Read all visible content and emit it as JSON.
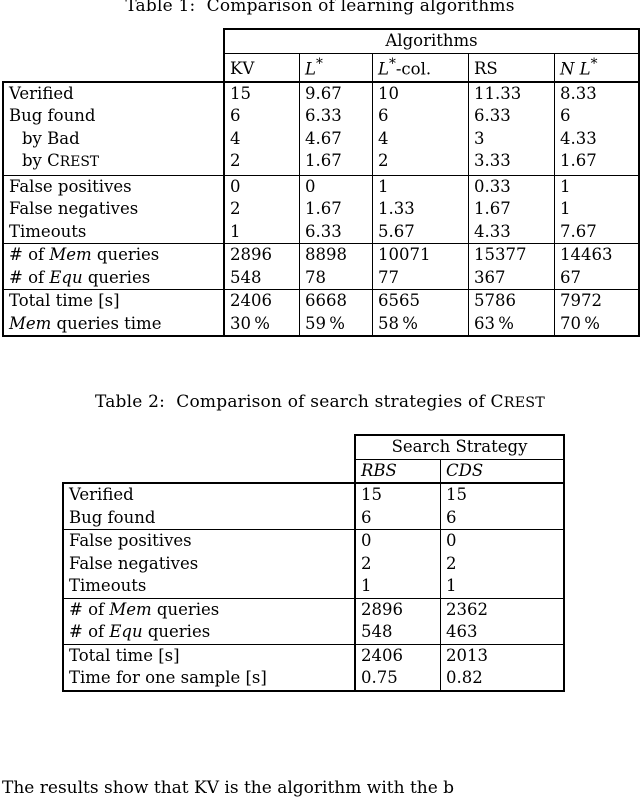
{
  "document": {
    "table1": {
      "caption": "Table 1:  Comparison of learning algorithms",
      "group_header": "Algorithms",
      "columns": [
        "KV",
        "L*",
        "L*-col.",
        "RS",
        "NL*"
      ],
      "column_styles": [
        "upright",
        "italic-math",
        "italic-math",
        "upright",
        "italic-math"
      ],
      "rows": [
        {
          "label": "Verified",
          "indent": false,
          "italic_word": "",
          "values": [
            "15",
            "9.67",
            "10",
            "11.33",
            "8.33"
          ]
        },
        {
          "label": "Bug found",
          "indent": false,
          "italic_word": "",
          "values": [
            "6",
            "6.33",
            "6",
            "6.33",
            "6"
          ]
        },
        {
          "label": "by Bad",
          "indent": true,
          "italic_word": "",
          "values": [
            "4",
            "4.67",
            "4",
            "3",
            "4.33"
          ]
        },
        {
          "label": "by CREST",
          "indent": true,
          "italic_word": "",
          "values": [
            "2",
            "1.67",
            "2",
            "3.33",
            "1.67"
          ]
        },
        {
          "label": "False positives",
          "indent": false,
          "italic_word": "",
          "values": [
            "0",
            "0",
            "1",
            "0.33",
            "1"
          ]
        },
        {
          "label": "False negatives",
          "indent": false,
          "italic_word": "",
          "values": [
            "2",
            "1.67",
            "1.33",
            "1.67",
            "1"
          ]
        },
        {
          "label": "Timeouts",
          "indent": false,
          "italic_word": "",
          "values": [
            "1",
            "6.33",
            "5.67",
            "4.33",
            "7.67"
          ]
        },
        {
          "label": "# of Mem queries",
          "indent": false,
          "italic_word": "Mem",
          "values": [
            "2896",
            "8898",
            "10071",
            "15377",
            "14463"
          ]
        },
        {
          "label": "# of Equ queries",
          "indent": false,
          "italic_word": "Equ",
          "values": [
            "548",
            "78",
            "77",
            "367",
            "67"
          ]
        },
        {
          "label": "Total time [s]",
          "indent": false,
          "italic_word": "",
          "values": [
            "2406",
            "6668",
            "6565",
            "5786",
            "7972"
          ]
        },
        {
          "label": "Mem queries time",
          "indent": false,
          "italic_word": "Mem",
          "values": [
            "30 %",
            "59 %",
            "58 %",
            "63 %",
            "70 %"
          ]
        }
      ],
      "group_breaks_after_row": [
        3,
        6,
        8
      ]
    },
    "table2": {
      "caption": "Table 2:  Comparison of search strategies of CREST",
      "group_header": "Search Strategy",
      "columns": [
        "RBS",
        "CDS"
      ],
      "rows": [
        {
          "label": "Verified",
          "italic_word": "",
          "values": [
            "15",
            "15"
          ]
        },
        {
          "label": "Bug found",
          "italic_word": "",
          "values": [
            "6",
            "6"
          ]
        },
        {
          "label": "False positives",
          "italic_word": "",
          "values": [
            "0",
            "0"
          ]
        },
        {
          "label": "False negatives",
          "italic_word": "",
          "values": [
            "2",
            "2"
          ]
        },
        {
          "label": "Timeouts",
          "italic_word": "",
          "values": [
            "1",
            "1"
          ]
        },
        {
          "label": "# of Mem queries",
          "italic_word": "Mem",
          "values": [
            "2896",
            "2362"
          ]
        },
        {
          "label": "# of Equ queries",
          "italic_word": "Equ",
          "values": [
            "548",
            "463"
          ]
        },
        {
          "label": "Total time [s]",
          "italic_word": "",
          "values": [
            "2406",
            "2013"
          ]
        },
        {
          "label": "Time for one sample [s]",
          "italic_word": "",
          "values": [
            "0.75",
            "0.82"
          ]
        }
      ],
      "group_breaks_after_row": [
        1,
        4,
        6
      ]
    },
    "body_text": "The results show that KV is the algorithm with the b"
  }
}
